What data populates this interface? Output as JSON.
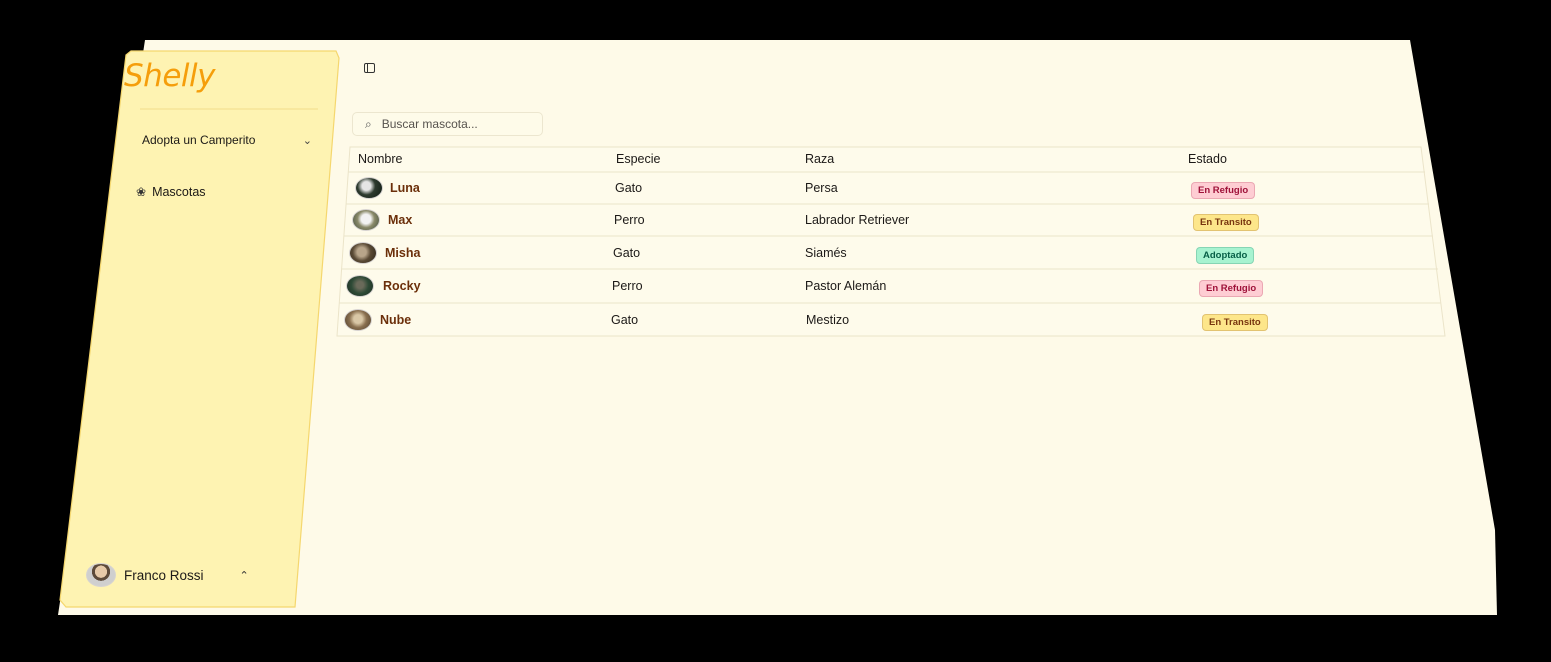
{
  "sidebar": {
    "brand": "Shelly",
    "group_label": "Adopta un Camperito",
    "items": [
      {
        "label": "Mascotas",
        "icon": "paw-icon"
      }
    ],
    "user": {
      "name": "Franco Rossi"
    }
  },
  "search": {
    "placeholder": "Buscar mascota..."
  },
  "table": {
    "headers": {
      "name": "Nombre",
      "species": "Especie",
      "breed": "Raza",
      "status": "Estado"
    },
    "rows": [
      {
        "name": "Luna",
        "species": "Gato",
        "breed": "Persa",
        "status": "En Refugio",
        "status_kind": "refugio"
      },
      {
        "name": "Max",
        "species": "Perro",
        "breed": "Labrador Retriever",
        "status": "En Transito",
        "status_kind": "transito"
      },
      {
        "name": "Misha",
        "species": "Gato",
        "breed": "Siamés",
        "status": "Adoptado",
        "status_kind": "adoptado"
      },
      {
        "name": "Rocky",
        "species": "Perro",
        "breed": "Pastor Alemán",
        "status": "En Refugio",
        "status_kind": "refugio"
      },
      {
        "name": "Nube",
        "species": "Gato",
        "breed": "Mestizo",
        "status": "En Transito",
        "status_kind": "transito"
      }
    ]
  },
  "colors": {
    "background": "#fefae8",
    "sidebar": "#fef3b2",
    "brand": "#f59e0b",
    "refugio_bg": "#fecdd3",
    "refugio_fg": "#9f1239",
    "transito_bg": "#fde68a",
    "transito_fg": "#78350f",
    "adoptado_bg": "#a7f3d0",
    "adoptado_fg": "#065f46"
  }
}
